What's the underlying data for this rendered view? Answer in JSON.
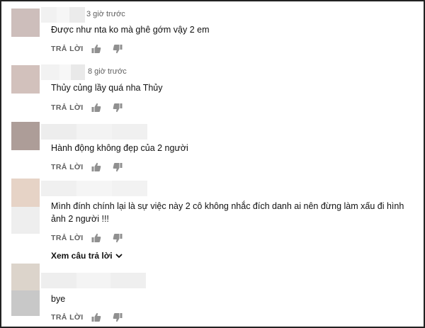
{
  "comments": [
    {
      "time": "3 giờ trước",
      "text": "Được như nta ko mà ghê gớm vậy 2 em",
      "reply_label": "TRẢ LỜI"
    },
    {
      "time": "8 giờ trước",
      "text": "Thủy củng lầy quá nha Thủy",
      "reply_label": "TRẢ LỜI"
    },
    {
      "time": "",
      "text": "Hành động không đẹp của 2 người",
      "reply_label": "TRẢ LỜI"
    },
    {
      "time": "",
      "text": "Mình đính chính lại là sự việc này 2 cô không nhắc đích danh ai nên đừng làm xấu đi hình ảnh 2 người !!!",
      "reply_label": "TRẢ LỜI"
    },
    {
      "time": "",
      "text": "bye",
      "reply_label": "TRẢ LỜI"
    }
  ],
  "view_replies_label": "Xem câu trả lời",
  "icons": {
    "like": "thumbs-up-icon",
    "dislike": "thumbs-down-icon",
    "expand": "chevron-down-icon"
  },
  "colors": {
    "secondary_text": "#606060",
    "icon": "#909090"
  }
}
